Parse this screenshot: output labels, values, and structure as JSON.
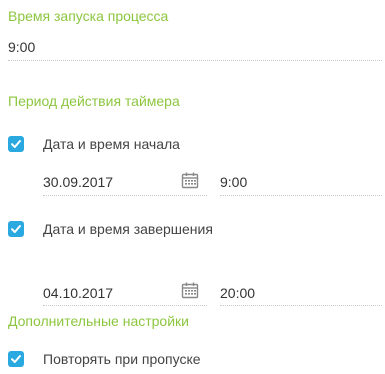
{
  "launch_time": {
    "title": "Время запуска процесса",
    "value": "9:00"
  },
  "timer_period": {
    "title": "Период действия таймера",
    "start": {
      "label": "Дата и время начала",
      "checked": true,
      "date": "30.09.2017",
      "time": "9:00"
    },
    "end": {
      "label": "Дата и время завершения",
      "checked": true,
      "date": "04.10.2017",
      "time": "20:00"
    }
  },
  "additional": {
    "title": "Дополнительные настройки",
    "repeat_on_miss": {
      "label": "Повторять при пропуске",
      "checked": true
    }
  },
  "colors": {
    "section_title": "#8cc63f",
    "checkbox": "#2aa9e0",
    "text": "#333333",
    "icon": "#888888"
  }
}
